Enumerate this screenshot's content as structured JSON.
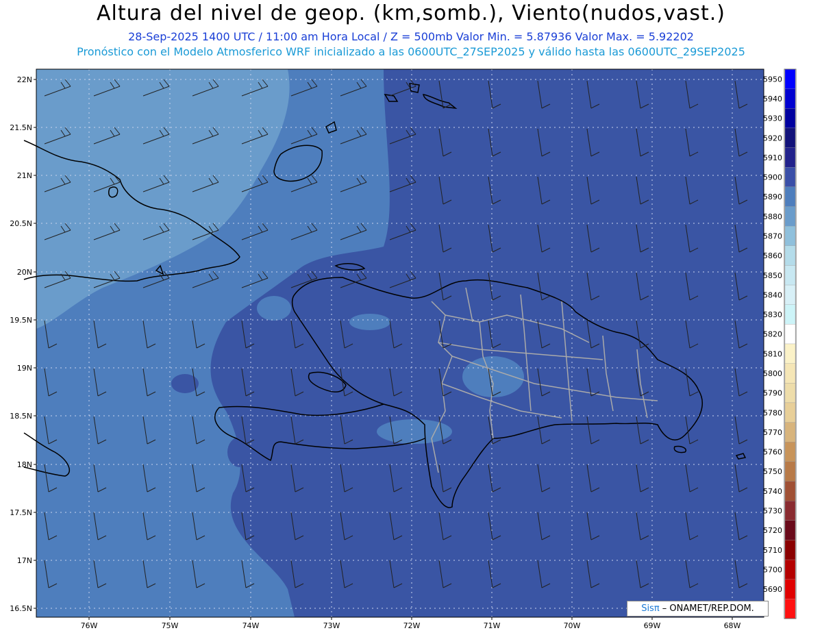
{
  "header": {
    "title": "Altura del nivel de geop. (km,somb.), Viento(nudos,vast.)",
    "subtitle1": "28-Sep-2025  1400 UTC / 11:00 am Hora Local / Z = 500mb    Valor Min. = 5.87936  Valor Max. = 5.92202",
    "subtitle2": "Pronóstico con el Modelo Atmosferico WRF inicializado a las 0600UTC_27SEP2025 y válido hasta las  0600UTC_29SEP2025"
  },
  "map": {
    "lat_labels": [
      "22N",
      "21.5N",
      "21N",
      "20.5N",
      "20N",
      "19.5N",
      "19N",
      "18.5N",
      "18N",
      "17.5N",
      "17N",
      "16.5N"
    ],
    "lon_labels": [
      "76W",
      "75W",
      "74W",
      "73W",
      "72W",
      "71W",
      "70W",
      "69W",
      "68W"
    ],
    "region": "Hispaniola / Caribbean"
  },
  "legend": {
    "levels": [
      {
        "label": "5950",
        "color": "#0000ff"
      },
      {
        "label": "5940",
        "color": "#0000d0"
      },
      {
        "label": "5930",
        "color": "#0000a0"
      },
      {
        "label": "5920",
        "color": "#12127a"
      },
      {
        "label": "5910",
        "color": "#22228c"
      },
      {
        "label": "5900",
        "color": "#3a4fa8"
      },
      {
        "label": "5890",
        "color": "#4e7ebd"
      },
      {
        "label": "5880",
        "color": "#6a9ccb"
      },
      {
        "label": "5870",
        "color": "#8fc0dc"
      },
      {
        "label": "5860",
        "color": "#b4dcea"
      },
      {
        "label": "5850",
        "color": "#c8e8f2"
      },
      {
        "label": "5840",
        "color": "#d8f0f7"
      },
      {
        "label": "5830",
        "color": "#cdf4f8"
      },
      {
        "label": "5820",
        "color": "#ffffff"
      },
      {
        "label": "5810",
        "color": "#fbf2c8"
      },
      {
        "label": "5800",
        "color": "#f5e6b6"
      },
      {
        "label": "5790",
        "color": "#eeddaa"
      },
      {
        "label": "5780",
        "color": "#e8cf98"
      },
      {
        "label": "5770",
        "color": "#d8b47c"
      },
      {
        "label": "5760",
        "color": "#c8945a"
      },
      {
        "label": "5750",
        "color": "#b87a48"
      },
      {
        "label": "5740",
        "color": "#a05034"
      },
      {
        "label": "5730",
        "color": "#8a2b30"
      },
      {
        "label": "5720",
        "color": "#6a0a1a"
      },
      {
        "label": "5710",
        "color": "#8a0000"
      },
      {
        "label": "5700",
        "color": "#b40000"
      },
      {
        "label": "5690",
        "color": "#e00000"
      },
      {
        "label": "",
        "color": "#ff1010"
      }
    ]
  },
  "credit": {
    "sis": "Sisπ",
    "rest": " – ONAMET/REP.DOM."
  }
}
